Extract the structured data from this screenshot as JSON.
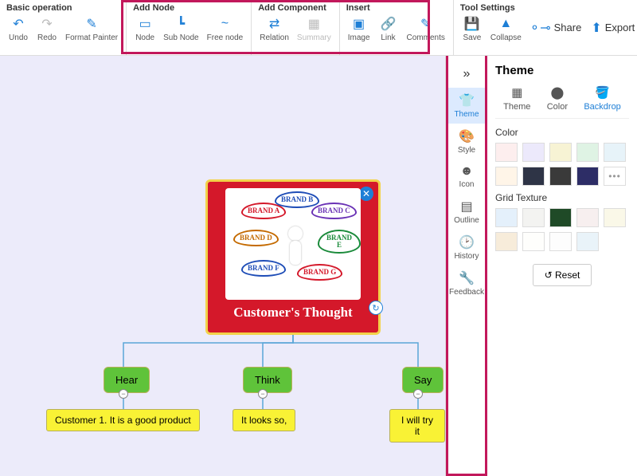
{
  "toolbar": {
    "groups": {
      "basic": {
        "title": "Basic operation",
        "undo": "Undo",
        "redo": "Redo",
        "format_painter": "Format Painter"
      },
      "add_node": {
        "title": "Add Node",
        "node": "Node",
        "sub_node": "Sub Node",
        "free_node": "Free node"
      },
      "add_component": {
        "title": "Add Component",
        "relation": "Relation",
        "summary": "Summary"
      },
      "insert": {
        "title": "Insert",
        "image": "Image",
        "link": "Link",
        "comments": "Comments"
      },
      "tool_settings": {
        "title": "Tool Settings",
        "save": "Save",
        "collapse": "Collapse"
      }
    },
    "right": {
      "share": "Share",
      "export": "Export"
    }
  },
  "sidepanel": {
    "title": "Theme",
    "tabs": {
      "theme": "Theme",
      "style": "Style",
      "icon": "Icon",
      "outline": "Outline",
      "history": "History",
      "feedback": "Feedback"
    },
    "subtabs": {
      "theme": "Theme",
      "color": "Color",
      "backdrop": "Backdrop"
    },
    "sections": {
      "color": "Color",
      "grid_texture": "Grid Texture"
    },
    "reset": "Reset",
    "color_swatches": [
      "#fdeeee",
      "#ece9fb",
      "#f7f3d4",
      "#dff3e4",
      "#e7f3f9",
      "#fff5e8",
      "#2e3446",
      "#3a3a3a",
      "#2d2d66"
    ],
    "color_more": "•••",
    "texture_swatches": [
      "#e4f0fb",
      "#f3f3f1",
      "#1f4a27",
      "#f7efef",
      "#faf8e8",
      "#f7ecda",
      "#fefefc",
      "#fdfdfd",
      "#e9f3f9"
    ]
  },
  "mindmap": {
    "root_title": "Customer's Thought",
    "root_brands": [
      "BRAND A",
      "BRAND B",
      "BRAND C",
      "BRAND D",
      "BRAND E",
      "BRAND F",
      "BRAND G"
    ],
    "nodes": {
      "hear": {
        "label": "Hear",
        "child": "Customer 1. It is a good product"
      },
      "think": {
        "label": "Think",
        "child": "It looks so,"
      },
      "say": {
        "label": "Say",
        "child": "I will try it"
      }
    }
  }
}
